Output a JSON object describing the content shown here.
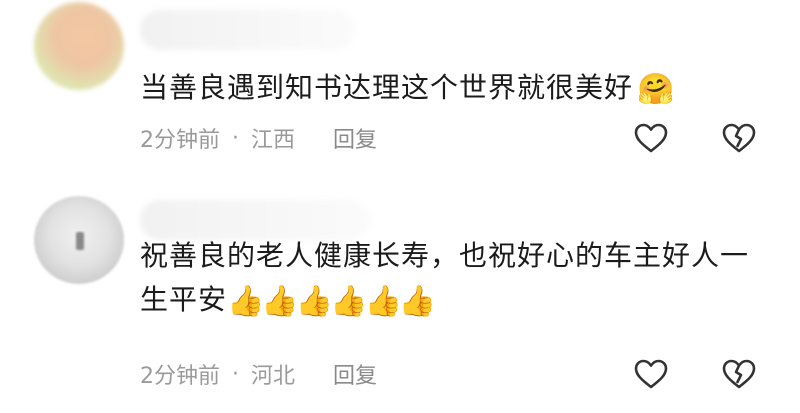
{
  "comments": [
    {
      "text": "当善良遇到知书达理这个世界就很美好",
      "emoji": "🤗",
      "time": "2分钟前",
      "separator": "·",
      "location": "江西",
      "reply_label": "回复"
    },
    {
      "text": "祝善良的老人健康长寿，也祝好心的车主好人一生平安",
      "emoji": "👍",
      "time": "2分钟前",
      "separator": "·",
      "location": "河北",
      "reply_label": "回复"
    }
  ],
  "icons": {
    "like": "heart-outline-icon",
    "dislike": "broken-heart-outline-icon"
  },
  "colors": {
    "text": "#1b1b1b",
    "meta": "#9a9a9a",
    "icon": "#333333"
  }
}
